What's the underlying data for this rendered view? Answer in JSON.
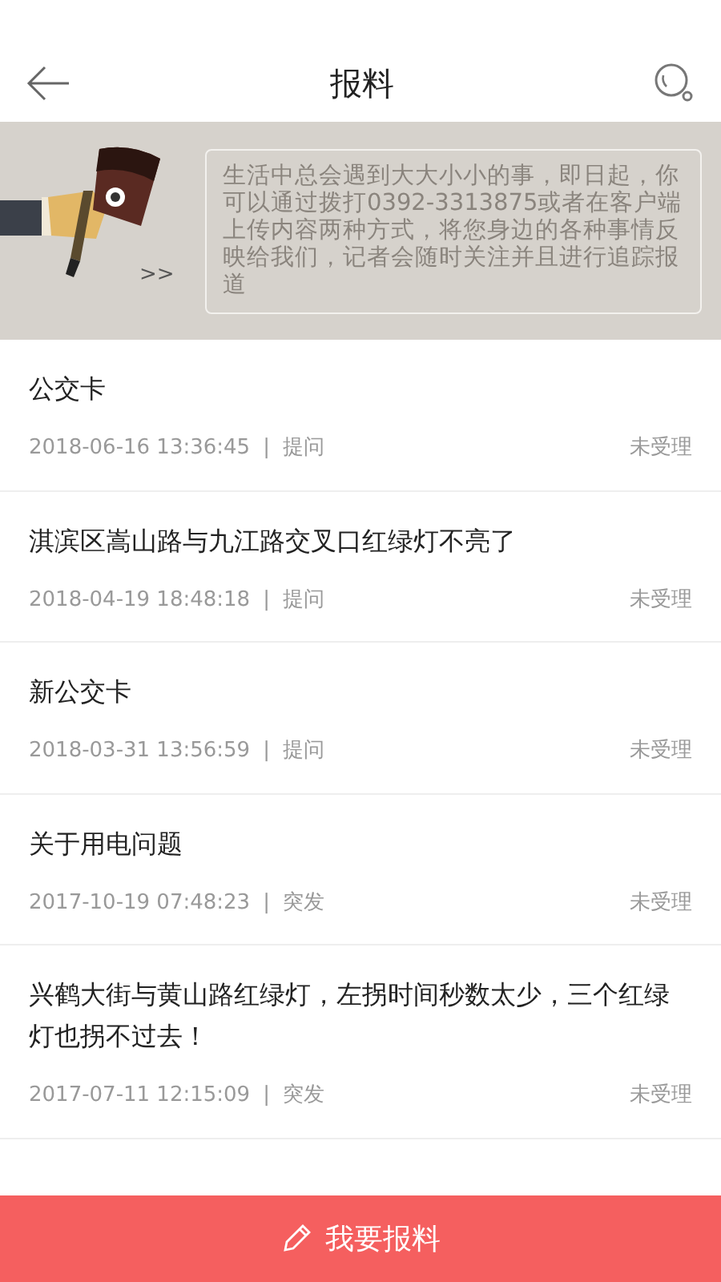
{
  "header": {
    "title": "报料"
  },
  "banner": {
    "arrows": ">>",
    "text": "生活中总会遇到大大小小的事，即日起，你可以通过拨打0392-3313875或者在客户端上传内容两种方式，将您身边的各种事情反映给我们，记者会随时关注并且进行追踪报道"
  },
  "reports": [
    {
      "title": "公交卡",
      "time": "2018-06-16 13:36:45",
      "separator": "|",
      "category": "提问",
      "status": "未受理"
    },
    {
      "title": "淇滨区嵩山路与九江路交叉口红绿灯不亮了",
      "time": "2018-04-19 18:48:18",
      "separator": "|",
      "category": "提问",
      "status": "未受理"
    },
    {
      "title": "新公交卡",
      "time": "2018-03-31 13:56:59",
      "separator": "|",
      "category": "提问",
      "status": "未受理"
    },
    {
      "title": "关于用电问题",
      "time": "2017-10-19 07:48:23",
      "separator": "|",
      "category": "突发",
      "status": "未受理"
    },
    {
      "title": "兴鹤大街与黄山路红绿灯，左拐时间秒数太少，三个红绿灯也拐不过去！",
      "time": "2017-07-11 12:15:09",
      "separator": "|",
      "category": "突发",
      "status": "未受理"
    }
  ],
  "action_button": {
    "label": "我要报料"
  }
}
